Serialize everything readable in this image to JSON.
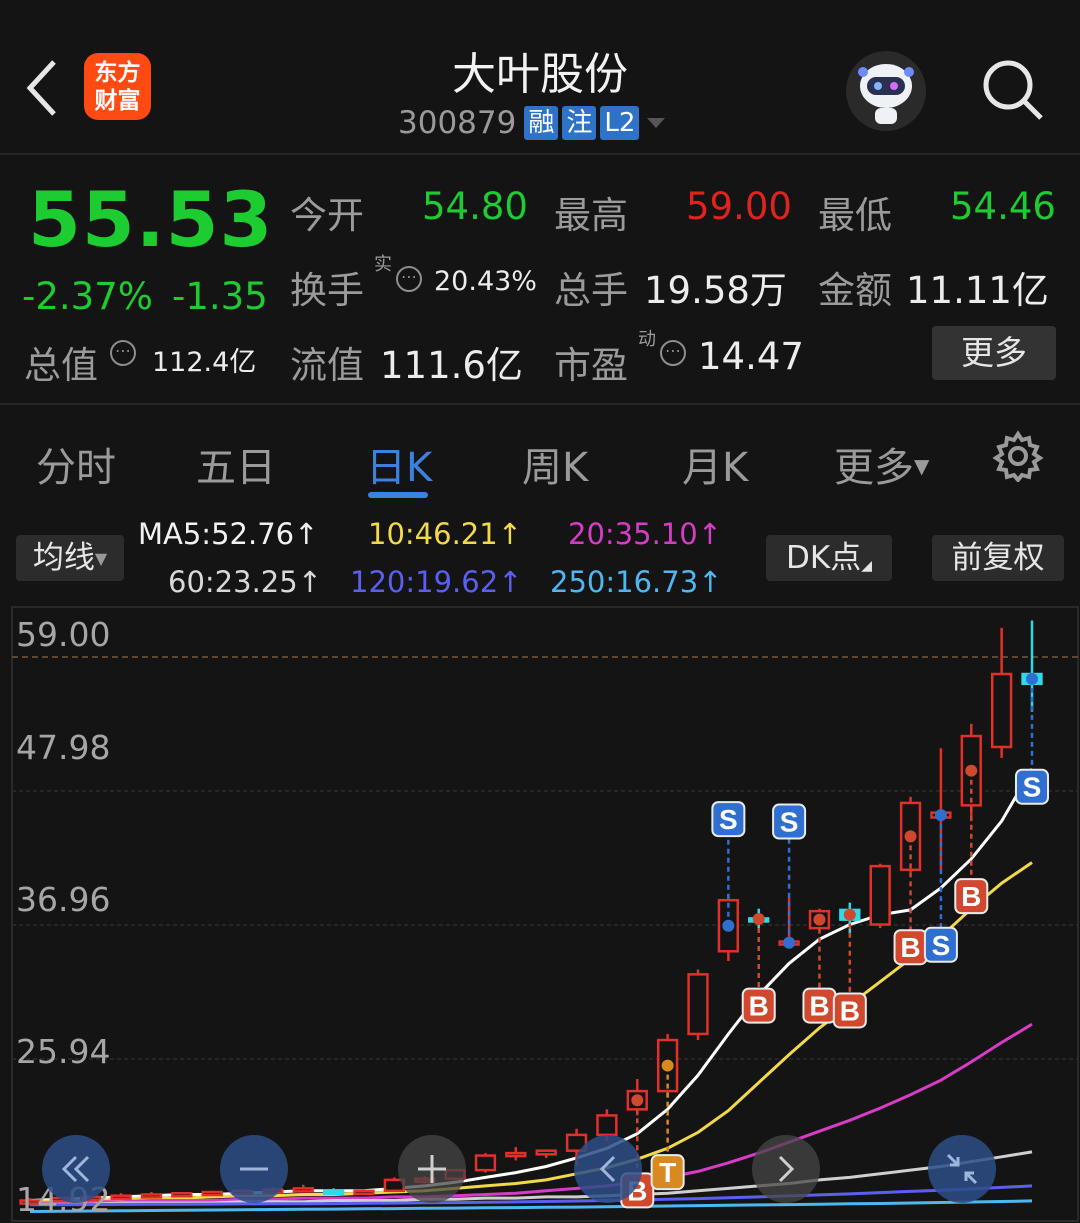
{
  "header": {
    "title": "大叶股份",
    "code": "300879",
    "tags": [
      "融",
      "注",
      "L2"
    ],
    "logo_text": "东方财富"
  },
  "quote": {
    "price": "55.53",
    "change_pct": "-2.37%",
    "change": "-1.35",
    "open_label": "今开",
    "open_value": "54.80",
    "high_label": "最高",
    "high_value": "59.00",
    "low_label": "最低",
    "low_value": "54.46",
    "turnover_label": "换手",
    "turnover_sup": "实",
    "turnover_value": "20.43%",
    "volume_label": "总手",
    "volume_value": "19.58万",
    "amount_label": "金额",
    "amount_value": "11.11亿",
    "mktcap_label": "总值",
    "mktcap_value": "112.4亿",
    "float_label": "流值",
    "float_value": "111.6亿",
    "pe_label": "市盈",
    "pe_sup": "动",
    "pe_value": "14.47",
    "more_label": "更多"
  },
  "tabs": [
    {
      "label": "分时"
    },
    {
      "label": "五日"
    },
    {
      "label": "日K",
      "active": true
    },
    {
      "label": "周K"
    },
    {
      "label": "月K"
    },
    {
      "label": "更多"
    }
  ],
  "ma": {
    "chip": "均线",
    "ma5": "MA5:52.76",
    "ma10": "10:46.21",
    "ma20": "20:35.10",
    "ma60": "60:23.25",
    "ma120": "120:19.62",
    "ma250": "250:16.73",
    "dk_label": "DK点",
    "adjust_label": "前复权",
    "colors": {
      "ma5": "#ffffff",
      "ma10": "#f2d94a",
      "ma20": "#d63cc6",
      "ma60": "#cfcfcf",
      "ma120": "#5a5ff0",
      "ma250": "#4fb6f0"
    }
  },
  "chart_data": {
    "type": "candlestick",
    "y_ticks": [
      "59.00",
      "47.98",
      "36.96",
      "25.94",
      "14.92"
    ],
    "ylim": [
      14.92,
      59.0
    ],
    "reference_line": 59.0,
    "colors": {
      "up": "#e0312a",
      "down": "#30d9e8",
      "signal_S": "#2f6fd0",
      "signal_B": "#d0482e",
      "signal_T": "#d88a20"
    },
    "candles": [
      {
        "o": 14.2,
        "h": 14.5,
        "l": 13.9,
        "c": 14.3
      },
      {
        "o": 14.4,
        "h": 14.6,
        "l": 14.2,
        "c": 14.5
      },
      {
        "o": 14.5,
        "h": 14.7,
        "l": 14.3,
        "c": 14.6
      },
      {
        "o": 14.6,
        "h": 14.9,
        "l": 14.4,
        "c": 14.7
      },
      {
        "o": 14.7,
        "h": 15.0,
        "l": 14.5,
        "c": 14.8
      },
      {
        "o": 14.8,
        "h": 15.0,
        "l": 14.6,
        "c": 14.9
      },
      {
        "o": 14.9,
        "h": 15.1,
        "l": 14.7,
        "c": 15.0
      },
      {
        "o": 15.0,
        "h": 15.2,
        "l": 14.8,
        "c": 15.1
      },
      {
        "o": 15.1,
        "h": 15.4,
        "l": 14.9,
        "c": 15.2
      },
      {
        "o": 15.2,
        "h": 15.6,
        "l": 15.0,
        "c": 15.3
      },
      {
        "o": 15.1,
        "h": 15.3,
        "l": 14.9,
        "c": 15.0
      },
      {
        "o": 15.0,
        "h": 15.2,
        "l": 14.8,
        "c": 15.1
      },
      {
        "o": 15.1,
        "h": 16.2,
        "l": 15.0,
        "c": 16.0
      },
      {
        "o": 16.0,
        "h": 16.3,
        "l": 15.7,
        "c": 16.1
      },
      {
        "o": 16.1,
        "h": 16.9,
        "l": 15.9,
        "c": 16.8
      },
      {
        "o": 16.8,
        "h": 18.2,
        "l": 16.6,
        "c": 18.0
      },
      {
        "o": 18.0,
        "h": 18.7,
        "l": 17.6,
        "c": 18.2
      },
      {
        "o": 18.1,
        "h": 18.5,
        "l": 17.8,
        "c": 18.4
      },
      {
        "o": 18.4,
        "h": 20.2,
        "l": 17.2,
        "c": 19.7
      },
      {
        "o": 19.7,
        "h": 21.8,
        "l": 19.2,
        "c": 21.3
      },
      {
        "o": 21.8,
        "h": 24.3,
        "l": 21.3,
        "c": 23.3
      },
      {
        "o": 23.3,
        "h": 28.0,
        "l": 22.8,
        "c": 27.5
      },
      {
        "o": 28.0,
        "h": 33.3,
        "l": 27.5,
        "c": 32.9
      },
      {
        "o": 34.8,
        "h": 39.5,
        "l": 34.0,
        "c": 39.0
      },
      {
        "o": 37.5,
        "h": 38.3,
        "l": 36.5,
        "c": 37.4
      },
      {
        "o": 35.4,
        "h": 39.3,
        "l": 35.2,
        "c": 35.6
      },
      {
        "o": 36.7,
        "h": 38.3,
        "l": 36.5,
        "c": 38.1
      },
      {
        "o": 38.2,
        "h": 38.8,
        "l": 36.1,
        "c": 37.4
      },
      {
        "o": 37.0,
        "h": 42.0,
        "l": 36.7,
        "c": 41.8
      },
      {
        "o": 41.5,
        "h": 47.5,
        "l": 41.3,
        "c": 47.0
      },
      {
        "o": 45.8,
        "h": 51.5,
        "l": 41.5,
        "c": 46.2
      },
      {
        "o": 46.8,
        "h": 53.5,
        "l": 45.5,
        "c": 52.5
      },
      {
        "o": 51.6,
        "h": 61.4,
        "l": 50.7,
        "c": 57.6
      },
      {
        "o": 57.6,
        "h": 62.0,
        "l": 54.5,
        "c": 56.8
      }
    ],
    "ma_series": {
      "ma5": [
        14.3,
        14.4,
        14.5,
        14.6,
        14.7,
        14.8,
        14.8,
        14.9,
        15.0,
        15.1,
        15.1,
        15.1,
        15.3,
        15.5,
        15.8,
        16.2,
        16.6,
        17.1,
        17.8,
        18.6,
        19.8,
        21.8,
        24.6,
        28.0,
        31.2,
        33.8,
        35.8,
        37.0,
        37.8,
        38.2,
        40.0,
        42.4,
        45.5,
        49.8
      ],
      "ma10": [
        14.2,
        14.3,
        14.3,
        14.4,
        14.5,
        14.5,
        14.6,
        14.7,
        14.7,
        14.8,
        14.8,
        14.9,
        15.0,
        15.1,
        15.3,
        15.5,
        15.7,
        16.0,
        16.5,
        17.0,
        17.7,
        18.6,
        19.9,
        21.7,
        24.0,
        26.3,
        28.5,
        30.4,
        32.3,
        34.2,
        36.0,
        38.3,
        40.4,
        42.1
      ],
      "ma20": [
        14.1,
        14.1,
        14.2,
        14.2,
        14.3,
        14.3,
        14.3,
        14.4,
        14.4,
        14.5,
        14.5,
        14.5,
        14.6,
        14.6,
        14.7,
        14.8,
        14.9,
        15.1,
        15.3,
        15.5,
        15.8,
        16.2,
        16.7,
        17.4,
        18.2,
        19.1,
        20.0,
        20.9,
        21.9,
        23.0,
        24.2,
        25.7,
        27.3,
        28.8
      ],
      "ma60": [
        14.0,
        14.0,
        14.0,
        14.1,
        14.1,
        14.1,
        14.1,
        14.2,
        14.2,
        14.2,
        14.3,
        14.3,
        14.3,
        14.4,
        14.4,
        14.5,
        14.5,
        14.6,
        14.6,
        14.7,
        14.8,
        14.9,
        15.1,
        15.3,
        15.5,
        15.7,
        16.0,
        16.2,
        16.5,
        16.8,
        17.1,
        17.5,
        17.9,
        18.3
      ],
      "ma120": [
        13.95,
        13.96,
        13.97,
        13.98,
        13.99,
        14.0,
        14.01,
        14.02,
        14.03,
        14.04,
        14.05,
        14.07,
        14.09,
        14.11,
        14.13,
        14.16,
        14.19,
        14.22,
        14.26,
        14.3,
        14.35,
        14.4,
        14.46,
        14.53,
        14.6,
        14.68,
        14.76,
        14.85,
        14.95,
        15.05,
        15.15,
        15.26,
        15.38,
        15.5
      ],
      "ma250": [
        13.4,
        13.42,
        13.44,
        13.46,
        13.48,
        13.5,
        13.52,
        13.54,
        13.56,
        13.58,
        13.6,
        13.62,
        13.64,
        13.66,
        13.68,
        13.7,
        13.72,
        13.74,
        13.76,
        13.79,
        13.82,
        13.85,
        13.88,
        13.91,
        13.94,
        13.97,
        14.0,
        14.03,
        14.06,
        14.1,
        14.14,
        14.18,
        14.22,
        14.27
      ]
    },
    "signals": [
      {
        "i": 20,
        "type": "B",
        "pos": "below"
      },
      {
        "i": 21,
        "type": "T",
        "pos": "below"
      },
      {
        "i": 23,
        "type": "S",
        "pos": "above"
      },
      {
        "i": 24,
        "type": "B",
        "pos": "below"
      },
      {
        "i": 25,
        "type": "S",
        "pos": "above"
      },
      {
        "i": 26,
        "type": "B",
        "pos": "below"
      },
      {
        "i": 27,
        "type": "B",
        "pos": "below"
      },
      {
        "i": 29,
        "type": "B",
        "pos": "below"
      },
      {
        "i": 30,
        "type": "S",
        "pos": "below"
      },
      {
        "i": 31,
        "type": "B",
        "pos": "below"
      },
      {
        "i": 33,
        "type": "S",
        "pos": "below"
      }
    ]
  },
  "nav_icons": [
    "double-left-icon",
    "zoom-out-icon",
    "zoom-in-icon",
    "left-icon",
    "right-icon",
    "collapse-icon"
  ]
}
